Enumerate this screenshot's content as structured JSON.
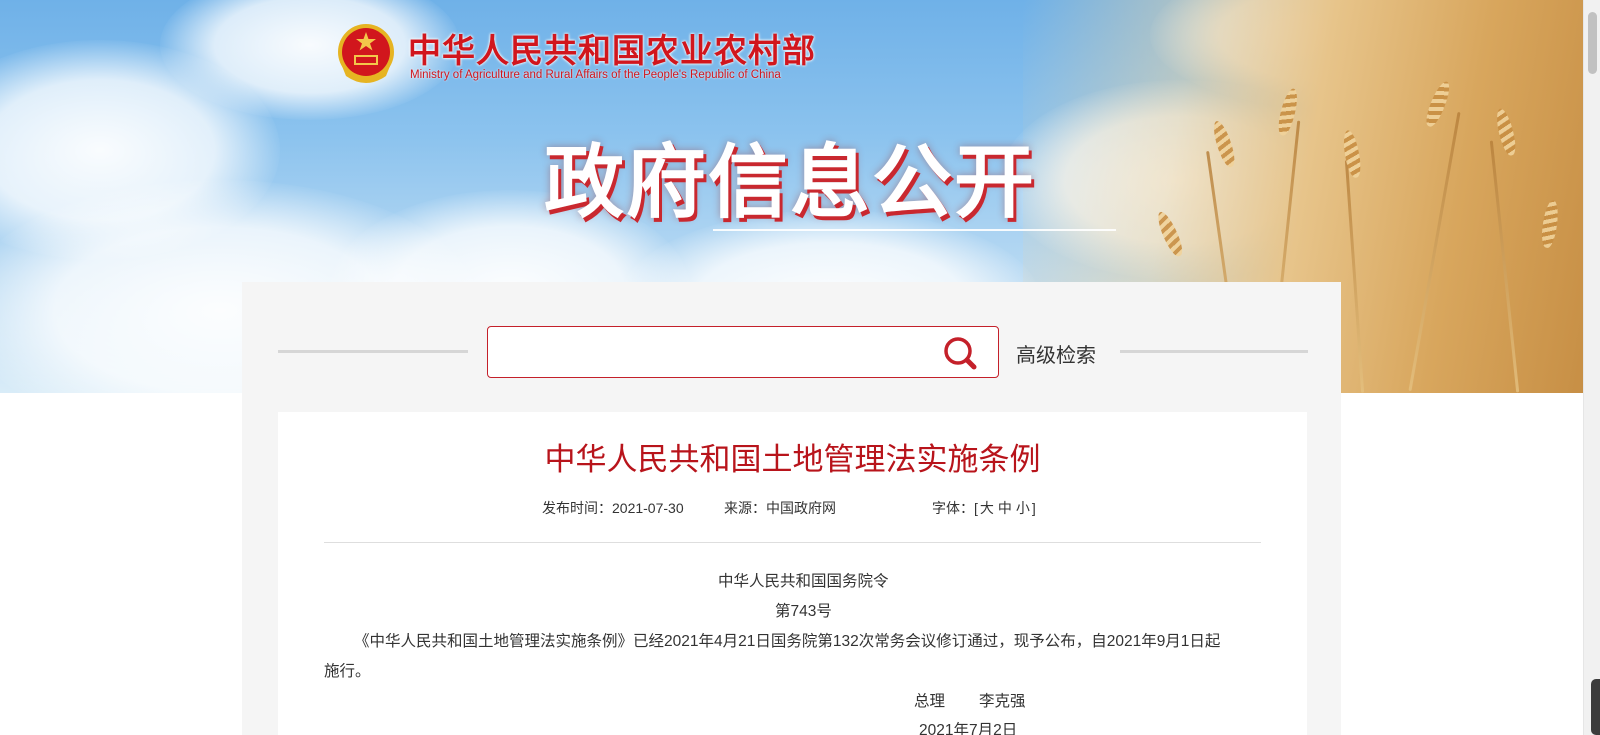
{
  "header": {
    "site_title": "中华人民共和国农业农村部",
    "site_subtitle": "Ministry of Agriculture and Rural Affairs of the People's Republic of China",
    "section_title": "政府信息公开",
    "emblem_icon": "national-emblem-icon"
  },
  "search": {
    "placeholder": "",
    "value": "",
    "search_icon": "search-icon",
    "advanced_label": "高级检索"
  },
  "article": {
    "title": "中华人民共和国土地管理法实施条例",
    "publish_label": "发布时间：2021-07-30",
    "source_label": "来源：中国政府网",
    "font_size_prefix": "字体：[",
    "font_large": "大",
    "font_medium": "中",
    "font_small": "小",
    "font_size_suffix": "]",
    "paragraphs": {
      "order_issuer": "中华人民共和国国务院令",
      "order_number": "第743号",
      "body_line1": "《中华人民共和国土地管理法实施条例》已经2021年4月21日国务院第132次常务会议修订通过，现予公布，自2021年9月1日起",
      "body_line2": "施行。",
      "signature_title": "总理",
      "signature_name": "李克强",
      "sign_date": "2021年7月2日"
    }
  },
  "colors": {
    "brand_red": "#c4202a",
    "title_red": "#b8141b",
    "panel_gray": "#f5f5f5"
  }
}
